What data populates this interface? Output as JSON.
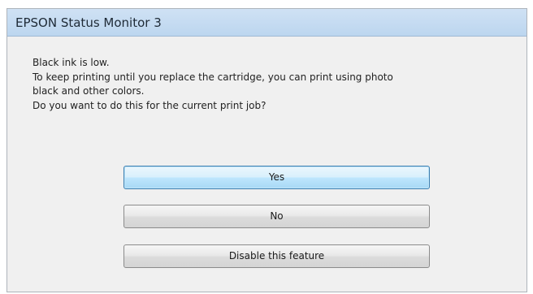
{
  "window": {
    "title": "EPSON Status Monitor 3"
  },
  "message": {
    "lines": [
      "Black ink is low.",
      "To keep printing until you replace the cartridge, you can print using photo",
      "black and other colors.",
      "Do you want to do this for the current print job?"
    ]
  },
  "buttons": {
    "yes": "Yes",
    "no": "No",
    "disable": "Disable this feature"
  },
  "colors": {
    "titlebar": "#c5dbf2",
    "dialog_background": "#f0f0f0",
    "default_button_border": "#3c7fb1"
  }
}
